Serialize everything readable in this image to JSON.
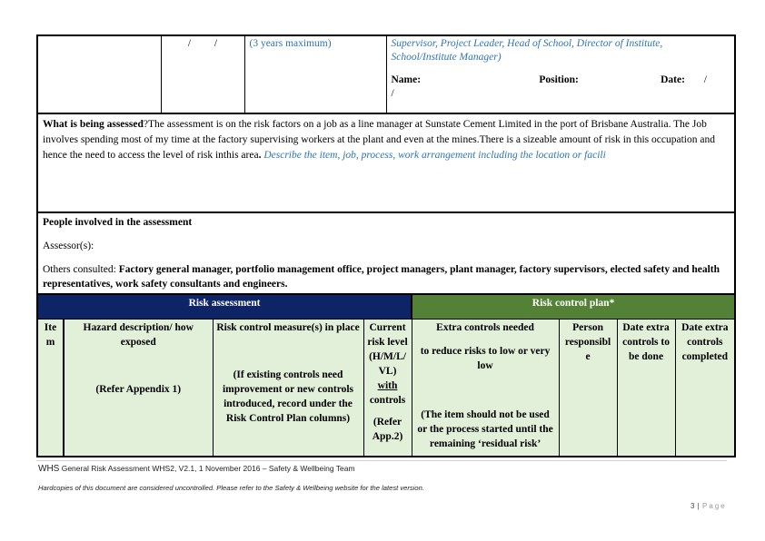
{
  "top_row": {
    "date_slashes": "/         /",
    "review_period": "(3 years maximum)",
    "approver_roles": "Supervisor, Project Leader, Head of School, Director of Institute, School/Institute Manager)",
    "name_label": "Name:",
    "position_label": "Position:",
    "date_label": "Date:",
    "date_slash_1": "/",
    "date_slash_2": "/"
  },
  "assessment": {
    "label": "What is being assessed",
    "text": "?The assessment is on the risk factors on a job as a line manager at Sunstate Cement Limited in the port of Brisbane Australia. The Job involves spending most of my time at the factory supervising workers at the plant and even at the mines.There  is a sizeable amount of risk in this occupation and hence the need to access the level of risk inthis area",
    "period_bold": ". ",
    "hint": "Describe the item, job, process, work arrangement including the location or facili"
  },
  "people": {
    "heading": "People involved in the assessment",
    "assessors_label": "Assessor(s):",
    "others_label": "Others consulted: ",
    "others_value": "Factory general manager, portfolio management office, project managers, plant manager, factory supervisors, elected safety and health representatives, work safety consultants and engineers."
  },
  "risk_table": {
    "section_assessment": "Risk assessment",
    "section_control_plan": "Risk control plan*",
    "columns": {
      "item": "Ite m",
      "hazard_title": "Hazard description/ how exposed",
      "hazard_note": "(Refer Appendix 1)",
      "control_title": "Risk control measure(s) in place",
      "control_note": "(If existing controls need improvement or new controls introduced, record under the Risk Control Plan columns)",
      "current_risk_1": "Current risk level (H/M/L/ VL)",
      "current_risk_with": "with",
      "current_risk_2": "controls",
      "current_risk_note": "(Refer App.2)",
      "extra_title": "Extra controls needed",
      "extra_sub": "to reduce risks to low or very low",
      "extra_note": "(The item should not be used or the process started until the remaining ‘residual risk’",
      "person": "Person responsibl e",
      "date_todo": "Date extra controls to be done",
      "date_done": "Date extra controls completed"
    }
  },
  "footer": {
    "doc_prefix": "WHS",
    "doc_info": " General Risk Assessment WHS2, V2.1, 1 November 2016 – Safety & Wellbeing Team",
    "disclaimer": "Hardcopies of this document are considered uncontrolled.  Please refer to the Safety & Wellbeing website for the latest version.",
    "page_number": "3",
    "page_sep": " | ",
    "page_label": "Page"
  },
  "colors": {
    "risk_assessment_header": "#0d2466",
    "risk_control_header": "#538135",
    "column_fill": "#e2efd9",
    "hint_blue": "#2e74b5"
  }
}
